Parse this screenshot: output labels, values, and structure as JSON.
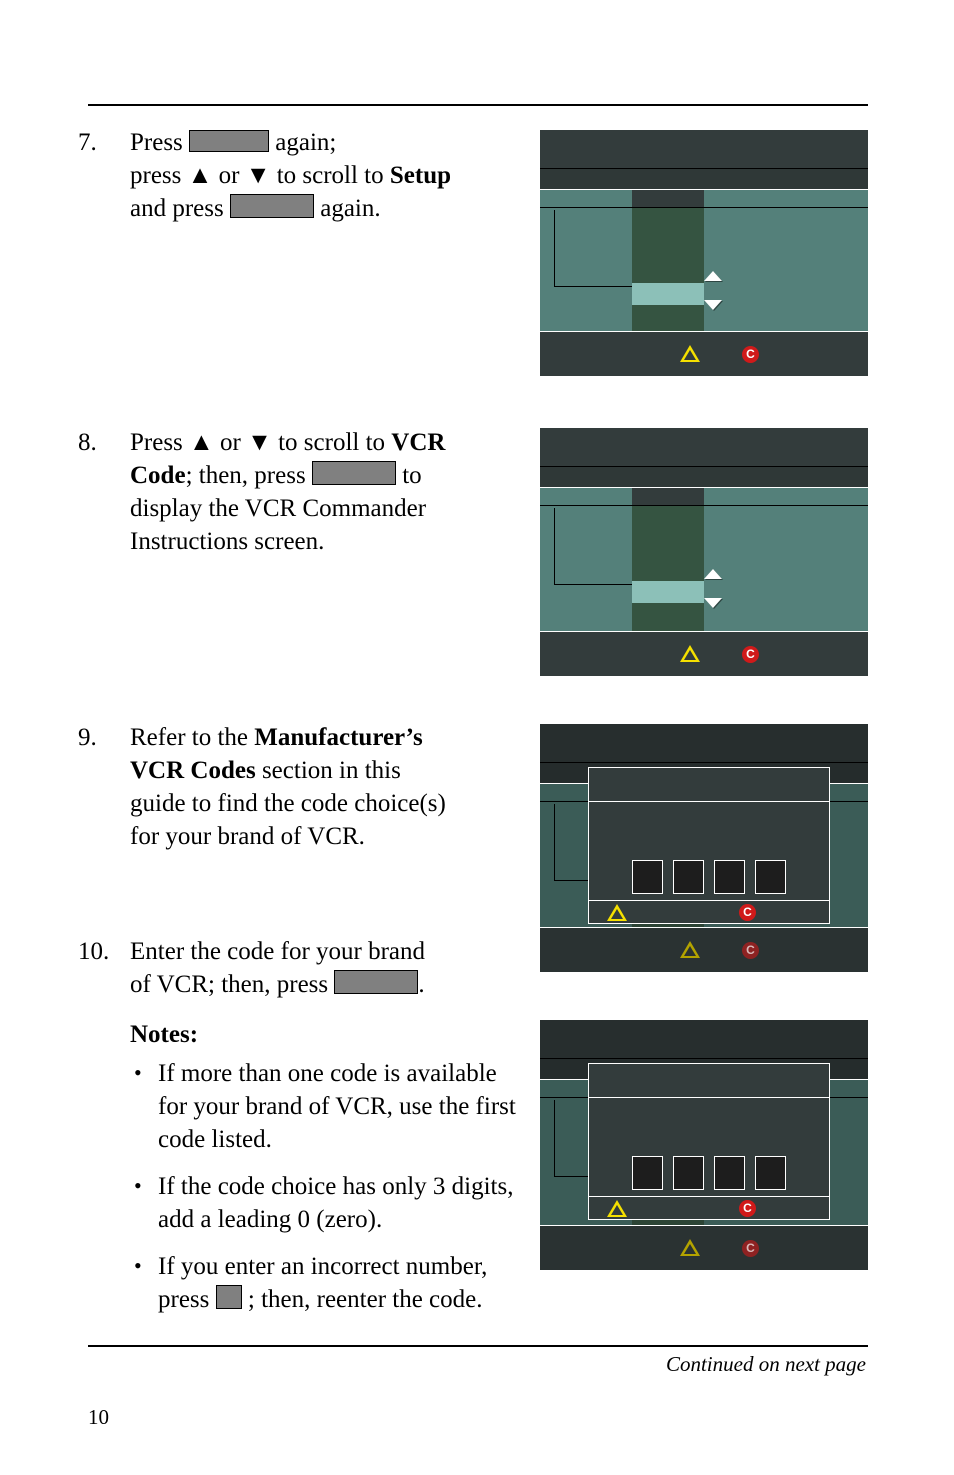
{
  "page": {
    "number": "10",
    "continued_note": "Continued on next page"
  },
  "steps": [
    {
      "number": "7.",
      "line1_pre": "Press",
      "line1_post": "again;",
      "line2": "press ▲ or ▼ to scroll to",
      "line2_bold": "Setup",
      "line3_pre": "and press",
      "line3_post": "again."
    },
    {
      "number": "8.",
      "line1": "Press ▲ or ▼ to scroll to",
      "line1_bold": "VCR",
      "line2_bold": "Code",
      "line2_mid": "; then, press",
      "line2_post": "to",
      "line3": "display the VCR Commander",
      "line4": "Instructions screen."
    },
    {
      "number": "9.",
      "line1": "Refer to the",
      "line1_bold": "Manufacturer’s",
      "line2_bold": "VCR Codes",
      "line2": "section in this",
      "line3": "guide to find the code choice(s)",
      "line4": "for your brand of VCR."
    },
    {
      "number": "10.",
      "line1": "Enter the code for your brand",
      "line2_pre": "of VCR; then, press",
      "line2_post": ".",
      "notes_heading": "Notes:",
      "notes": [
        "If more than one code is available for your brand of VCR, use the first code listed.",
        "If the code choice has only 3 digits, add a leading 0 (zero).",
        "If you enter an incorrect number, press",
        "; then, reenter the code."
      ]
    }
  ],
  "icons": {
    "warning": "warning-triangle-icon",
    "clear": "C",
    "scroll_up": "scroll-up-arrow-icon",
    "scroll_down": "scroll-down-arrow-icon"
  },
  "colors": {
    "screen_background": "#54807a",
    "screen_chrome": "#333c3c",
    "list_column": "#355441",
    "highlight": "#8cc0b8",
    "warning_yellow": "#f5e000",
    "clear_red": "#d01a1a",
    "key_placeholder": "#808080"
  },
  "screenshots": [
    {
      "id": "setup-menu-scroll",
      "type": "menu-list",
      "dimmed": false,
      "dialog": false
    },
    {
      "id": "vcr-code-scroll",
      "type": "menu-list",
      "dimmed": false,
      "dialog": false
    },
    {
      "id": "vcr-code-entry-1",
      "type": "code-dialog",
      "dimmed": true,
      "dialog": true,
      "digit_count": 4
    },
    {
      "id": "vcr-code-entry-2",
      "type": "code-dialog",
      "dimmed": true,
      "dialog": true,
      "digit_count": 4
    }
  ]
}
